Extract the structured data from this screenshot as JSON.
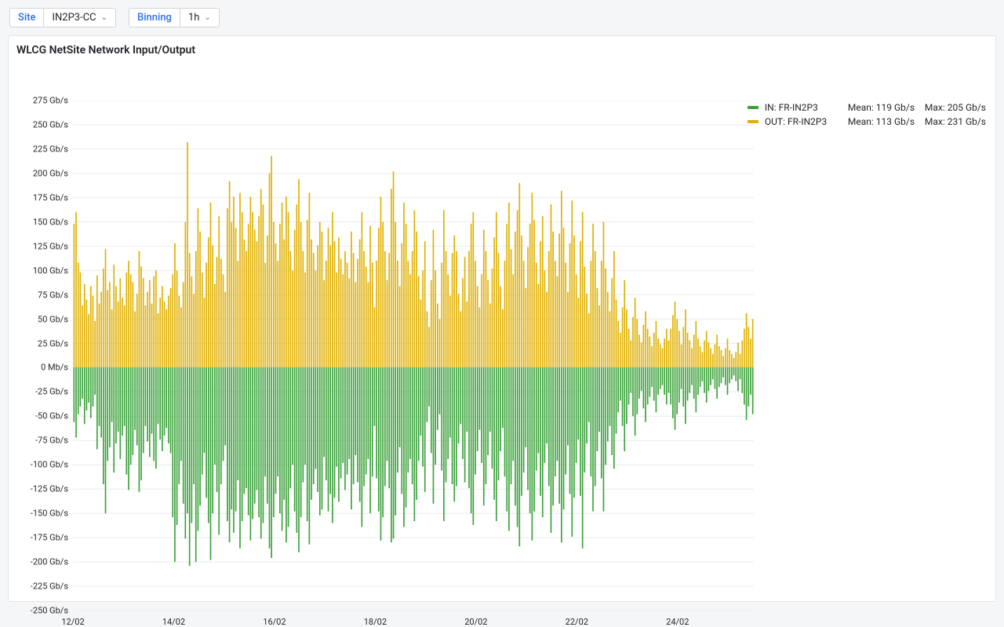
{
  "toolbar": {
    "site_label": "Site",
    "site_value": "IN2P3-CC",
    "binning_label": "Binning",
    "binning_value": "1h"
  },
  "panel": {
    "title": "WLCG NetSite Network Input/Output"
  },
  "legend": {
    "in": {
      "swatch": "#3aa23a",
      "name": "IN: FR-IN2P3",
      "mean": "Mean: 119 Gb/s",
      "max": "Max: 205 Gb/s"
    },
    "out": {
      "swatch": "#e0b000",
      "name": "OUT: FR-IN2P3",
      "mean": "Mean: 113 Gb/s",
      "max": "Max: 231 Gb/s"
    }
  },
  "chart_data": {
    "type": "bar",
    "title": "WLCG NetSite Network Input/Output",
    "xlabel": "",
    "ylabel": "",
    "ylim": [
      -250,
      275
    ],
    "yticks": [
      {
        "v": 275,
        "label": "275 Gb/s"
      },
      {
        "v": 250,
        "label": "250 Gb/s"
      },
      {
        "v": 225,
        "label": "225 Gb/s"
      },
      {
        "v": 200,
        "label": "200 Gb/s"
      },
      {
        "v": 175,
        "label": "175 Gb/s"
      },
      {
        "v": 150,
        "label": "150 Gb/s"
      },
      {
        "v": 125,
        "label": "125 Gb/s"
      },
      {
        "v": 100,
        "label": "100 Gb/s"
      },
      {
        "v": 75,
        "label": "75 Gb/s"
      },
      {
        "v": 50,
        "label": "50 Gb/s"
      },
      {
        "v": 25,
        "label": "25 Gb/s"
      },
      {
        "v": 0,
        "label": "0 Mb/s"
      },
      {
        "v": -25,
        "label": "-25 Gb/s"
      },
      {
        "v": -50,
        "label": "-50 Gb/s"
      },
      {
        "v": -75,
        "label": "-75 Gb/s"
      },
      {
        "v": -100,
        "label": "-100 Gb/s"
      },
      {
        "v": -125,
        "label": "-125 Gb/s"
      },
      {
        "v": -150,
        "label": "-150 Gb/s"
      },
      {
        "v": -175,
        "label": "-175 Gb/s"
      },
      {
        "v": -200,
        "label": "-200 Gb/s"
      },
      {
        "v": -225,
        "label": "-225 Gb/s"
      },
      {
        "v": -250,
        "label": "-250 Gb/s"
      }
    ],
    "xticks": [
      {
        "frac": 0.0,
        "label": "12/02"
      },
      {
        "frac": 0.148,
        "label": "14/02"
      },
      {
        "frac": 0.296,
        "label": "16/02"
      },
      {
        "frac": 0.444,
        "label": "18/02"
      },
      {
        "frac": 0.592,
        "label": "20/02"
      },
      {
        "frac": 0.74,
        "label": "22/02"
      },
      {
        "frac": 0.888,
        "label": "24/02"
      }
    ],
    "series": [
      {
        "name": "OUT: FR-IN2P3",
        "color": "#e0b000",
        "values": [
          148,
          160,
          108,
          98,
          64,
          86,
          70,
          55,
          84,
          74,
          48,
          95,
          66,
          78,
          102,
          122,
          80,
          88,
          60,
          106,
          84,
          68,
          92,
          72,
          64,
          98,
          110,
          96,
          88,
          58,
          76,
          120,
          104,
          92,
          64,
          78,
          90,
          66,
          94,
          100,
          56,
          72,
          84,
          68,
          60,
          74,
          82,
          96,
          128,
          100,
          74,
          62,
          88,
          150,
          232,
          118,
          94,
          76,
          120,
          164,
          140,
          98,
          72,
          108,
          134,
          170,
          126,
          86,
          114,
          156,
          112,
          96,
          78,
          164,
          192,
          150,
          176,
          144,
          110,
          180,
          160,
          132,
          120,
          148,
          176,
          160,
          142,
          130,
          156,
          184,
          168,
          108,
          136,
          200,
          218,
          150,
          128,
          110,
          148,
          170,
          132,
          176,
          160,
          120,
          100,
          142,
          168,
          194,
          150,
          120,
          98,
          152,
          180,
          132,
          118,
          100,
          126,
          150,
          140,
          90,
          110,
          144,
          126,
          160,
          130,
          98,
          134,
          112,
          96,
          120,
          108,
          92,
          140,
          118,
          88,
          112,
          132,
          160,
          120,
          104,
          88,
          146,
          108,
          62,
          110,
          144,
          176,
          150,
          120,
          90,
          118,
          184,
          202,
          150,
          110,
          84,
          128,
          170,
          148,
          110,
          96,
          120,
          162,
          140,
          94,
          70,
          100,
          130,
          58,
          42,
          90,
          142,
          100,
          66,
          50,
          108,
          162,
          120,
          96,
          74,
          118,
          136,
          120,
          76,
          58,
          92,
          114,
          68,
          120,
          148,
          160,
          110,
          84,
          62,
          96,
          142,
          120,
          90,
          66,
          102,
          134,
          160,
          118,
          84,
          60,
          110,
          148,
          170,
          122,
          96,
          140,
          162,
          190,
          136,
          110,
          82,
          124,
          148,
          180,
          152,
          108,
          86,
          130,
          156,
          100,
          78,
          120,
          168,
          140,
          110,
          94,
          138,
          182,
          144,
          108,
          78,
          128,
          172,
          136,
          96,
          72,
          130,
          160,
          104,
          76,
          56,
          110,
          148,
          120,
          82,
          64,
          110,
          150,
          102,
          78,
          58,
          92,
          120,
          70,
          48,
          36,
          62,
          90,
          60,
          40,
          28,
          52,
          72,
          50,
          34,
          26,
          44,
          58,
          40,
          32,
          22,
          36,
          48,
          30,
          24,
          20,
          30,
          40,
          28,
          40,
          54,
          68,
          50,
          38,
          24,
          42,
          60,
          36,
          28,
          20,
          34,
          48,
          30,
          22,
          16,
          28,
          38,
          26,
          20,
          14,
          24,
          34,
          22,
          18,
          12,
          20,
          30,
          18,
          14,
          10,
          16,
          26,
          14,
          28,
          40,
          56,
          42,
          30,
          50
        ]
      },
      {
        "name": "IN: FR-IN2P3",
        "color": "#3aa23a",
        "values": [
          56,
          72,
          48,
          40,
          32,
          58,
          44,
          36,
          52,
          40,
          28,
          84,
          60,
          72,
          120,
          150,
          96,
          82,
          56,
          108,
          78,
          66,
          94,
          70,
          60,
          110,
          126,
          100,
          90,
          64,
          80,
          128,
          116,
          88,
          60,
          76,
          92,
          68,
          96,
          104,
          58,
          74,
          86,
          70,
          62,
          78,
          88,
          154,
          200,
          162,
          120,
          96,
          140,
          176,
          150,
          204,
          160,
          120,
          200,
          168,
          142,
          110,
          88,
          134,
          160,
          198,
          150,
          100,
          128,
          172,
          120,
          96,
          80,
          158,
          180,
          146,
          170,
          148,
          116,
          186,
          158,
          130,
          124,
          152,
          178,
          156,
          140,
          126,
          154,
          176,
          160,
          112,
          140,
          186,
          196,
          154,
          130,
          112,
          150,
          168,
          136,
          180,
          164,
          124,
          100,
          148,
          170,
          190,
          154,
          118,
          100,
          158,
          182,
          136,
          120,
          104,
          128,
          152,
          146,
          92,
          116,
          148,
          130,
          160,
          134,
          102,
          138,
          114,
          98,
          126,
          110,
          94,
          146,
          120,
          90,
          118,
          138,
          164,
          122,
          110,
          94,
          150,
          112,
          60,
          114,
          148,
          178,
          154,
          122,
          96,
          124,
          180,
          176,
          152,
          108,
          82,
          130,
          164,
          144,
          108,
          94,
          120,
          158,
          136,
          96,
          70,
          102,
          128,
          56,
          40,
          88,
          140,
          100,
          64,
          48,
          106,
          158,
          118,
          94,
          72,
          120,
          138,
          122,
          78,
          58,
          94,
          118,
          66,
          124,
          150,
          162,
          110,
          86,
          64,
          98,
          142,
          120,
          90,
          66,
          104,
          136,
          158,
          116,
          86,
          62,
          112,
          148,
          168,
          120,
          96,
          142,
          164,
          184,
          132,
          108,
          82,
          126,
          150,
          178,
          148,
          106,
          88,
          132,
          154,
          98,
          78,
          122,
          170,
          142,
          112,
          96,
          140,
          180,
          146,
          110,
          80,
          130,
          174,
          134,
          98,
          74,
          132,
          186,
          108,
          78,
          56,
          112,
          148,
          122,
          86,
          66,
          114,
          148,
          100,
          76,
          60,
          90,
          104,
          68,
          46,
          34,
          60,
          86,
          58,
          38,
          26,
          50,
          70,
          48,
          32,
          24,
          42,
          56,
          38,
          30,
          20,
          34,
          46,
          28,
          22,
          18,
          28,
          38,
          26,
          38,
          52,
          64,
          48,
          36,
          22,
          40,
          58,
          34,
          26,
          18,
          32,
          46,
          28,
          20,
          14,
          26,
          36,
          24,
          18,
          12,
          22,
          32,
          20,
          16,
          10,
          18,
          28,
          16,
          12,
          8,
          14,
          24,
          12,
          26,
          38,
          54,
          40,
          28,
          48
        ]
      }
    ],
    "stats": {
      "in_mean": 119,
      "in_max": 205,
      "out_mean": 113,
      "out_max": 231
    }
  }
}
